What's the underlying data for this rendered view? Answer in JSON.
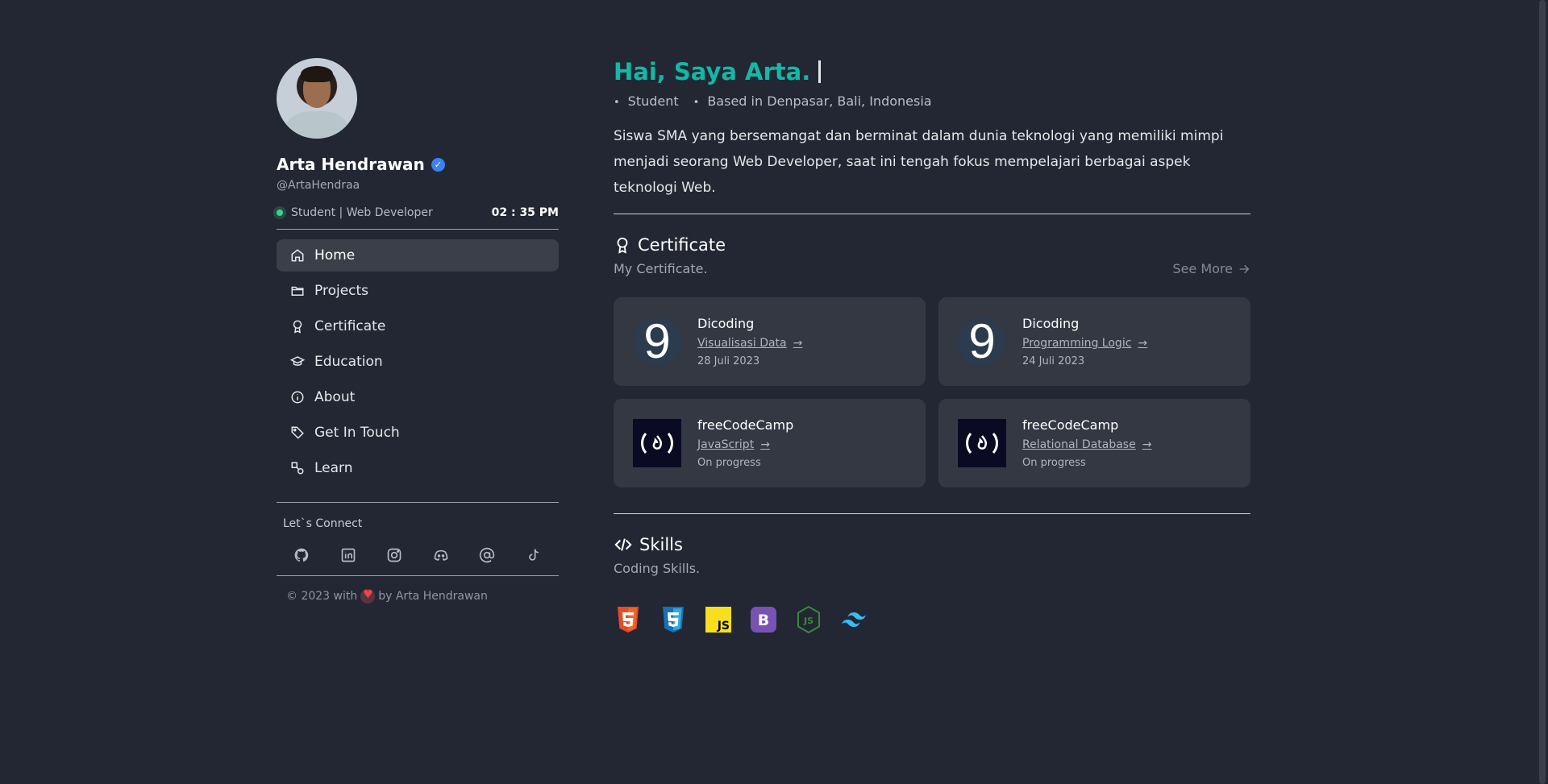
{
  "profile": {
    "name": "Arta Hendrawan",
    "handle": "@ArtaHendraa",
    "status": "Student | Web Developer",
    "time": "02 : 35 PM"
  },
  "nav": {
    "items": [
      {
        "label": "Home",
        "icon": "home-icon",
        "active": true
      },
      {
        "label": "Projects",
        "icon": "folder-icon"
      },
      {
        "label": "Certificate",
        "icon": "award-icon"
      },
      {
        "label": "Education",
        "icon": "graduation-cap-icon"
      },
      {
        "label": "About",
        "icon": "info-icon"
      },
      {
        "label": "Get In Touch",
        "icon": "tag-icon"
      },
      {
        "label": "Learn",
        "icon": "shapes-icon"
      }
    ]
  },
  "connect": {
    "title": "Let`s Connect",
    "socials": [
      "github-icon",
      "linkedin-icon",
      "instagram-icon",
      "discord-icon",
      "at-icon",
      "tiktok-icon"
    ]
  },
  "footer": {
    "prefix": "© 2023 with",
    "suffix": "by Arta Hendrawan"
  },
  "hero": {
    "title": "Hai, Saya Arta.",
    "meta": [
      "Student",
      "Based in Denpasar, Bali, Indonesia"
    ],
    "intro": "Siswa SMA yang bersemangat dan berminat dalam dunia teknologi yang memiliki mimpi menjadi seorang Web Developer, saat ini tengah fokus mempelajari berbagai aspek teknologi Web."
  },
  "certificate": {
    "title": "Certificate",
    "subtitle": "My Certificate.",
    "see_more": "See More",
    "items": [
      {
        "org": "Dicoding",
        "course": "Visualisasi Data",
        "date": "28 Juli 2023",
        "logo": "dicoding-logo"
      },
      {
        "org": "Dicoding",
        "course": "Programming Logic",
        "date": "24 Juli 2023",
        "logo": "dicoding-logo"
      },
      {
        "org": "freeCodeCamp",
        "course": "JavaScript",
        "date": "On progress",
        "logo": "freecodecamp-logo"
      },
      {
        "org": "freeCodeCamp",
        "course": "Relational Database",
        "date": "On progress",
        "logo": "freecodecamp-logo"
      }
    ]
  },
  "skills": {
    "title": "Skills",
    "subtitle": "Coding Skills.",
    "icons": [
      "html5-icon",
      "css3-icon",
      "javascript-icon",
      "bootstrap-icon",
      "nodejs-icon",
      "tailwind-icon"
    ]
  },
  "colors": {
    "background": "#222733",
    "accent": "#14b8a6",
    "card": "#333843",
    "online": "#34d399"
  }
}
